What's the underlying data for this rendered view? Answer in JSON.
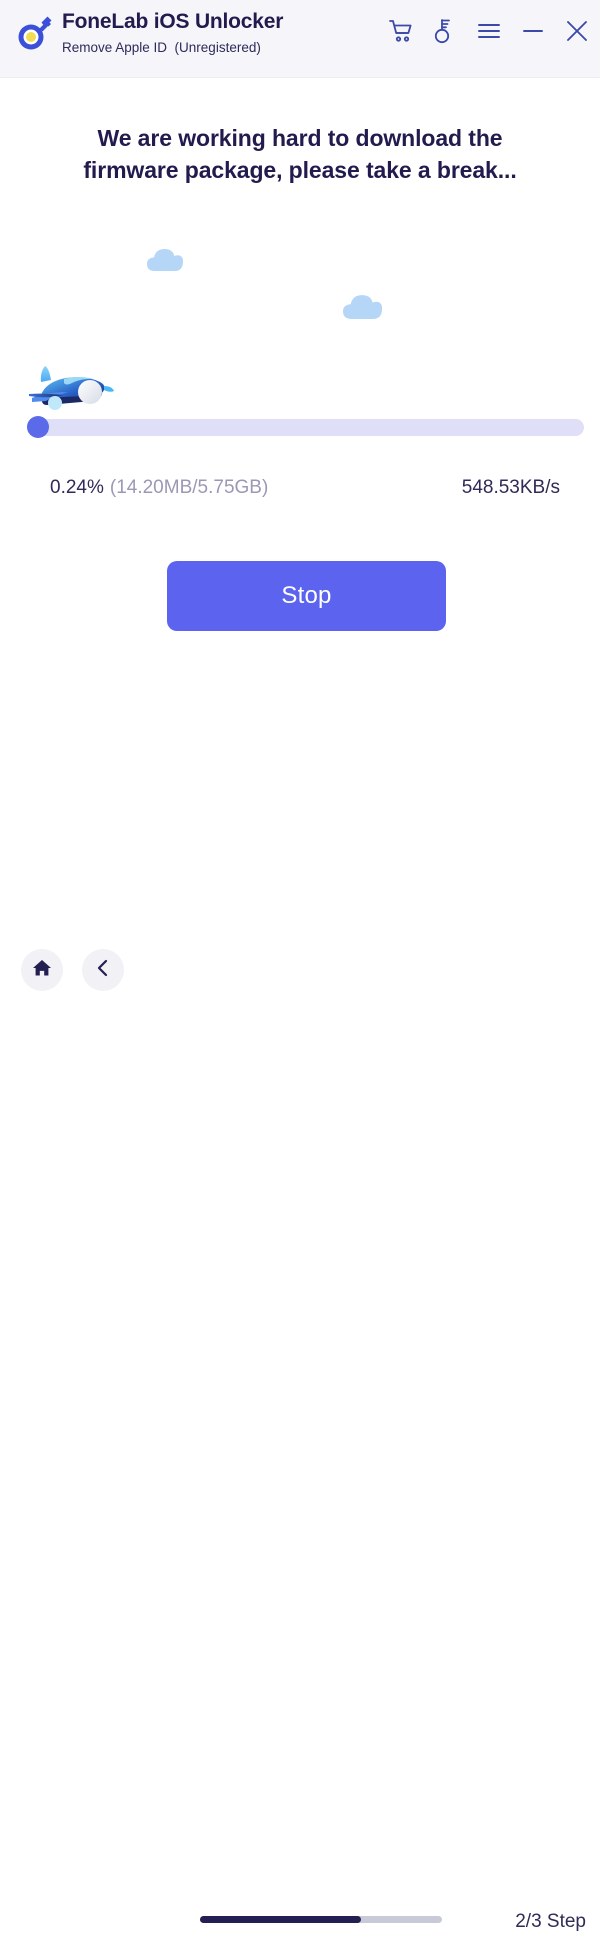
{
  "window": {
    "app_title": "FoneLab iOS Unlocker",
    "app_subtitle": "Remove Apple ID  (Unregistered)",
    "logo_icon": "key-circle-logo-icon",
    "controls": [
      {
        "name": "cart-icon",
        "label": "Cart"
      },
      {
        "name": "key-icon",
        "label": "Register"
      },
      {
        "name": "menu-icon",
        "label": "Menu"
      },
      {
        "name": "minimize-icon",
        "label": "Minimize"
      },
      {
        "name": "close-icon",
        "label": "Close"
      }
    ]
  },
  "main": {
    "heading_line1": "We are working hard to download the",
    "heading_line2": "firmware package, please take a break...",
    "illustration": {
      "plane_icon": "airplane-icon",
      "cloud_1_icon": "cloud-icon",
      "cloud_2_icon": "cloud-icon"
    },
    "download": {
      "percent_text": "0.24%",
      "size_text": "(14.20MB/5.75GB)",
      "speed_text": "548.53KB/s",
      "percent_value": 0.24,
      "downloaded": "14.20MB",
      "total": "5.75GB"
    },
    "stop_button_label": "Stop"
  },
  "footer": {
    "home_icon": "home-icon",
    "back_icon": "chevron-left-icon",
    "step_label": "2/3 Step",
    "step_current": 2,
    "step_total": 3
  },
  "colors": {
    "accent": "#5b63ef",
    "titlebar_bg": "#f6f6fa",
    "heading": "#211b4e",
    "track": "#dfe0f8",
    "step_fill": "#241f52",
    "cloud": "#b5d6f7"
  }
}
